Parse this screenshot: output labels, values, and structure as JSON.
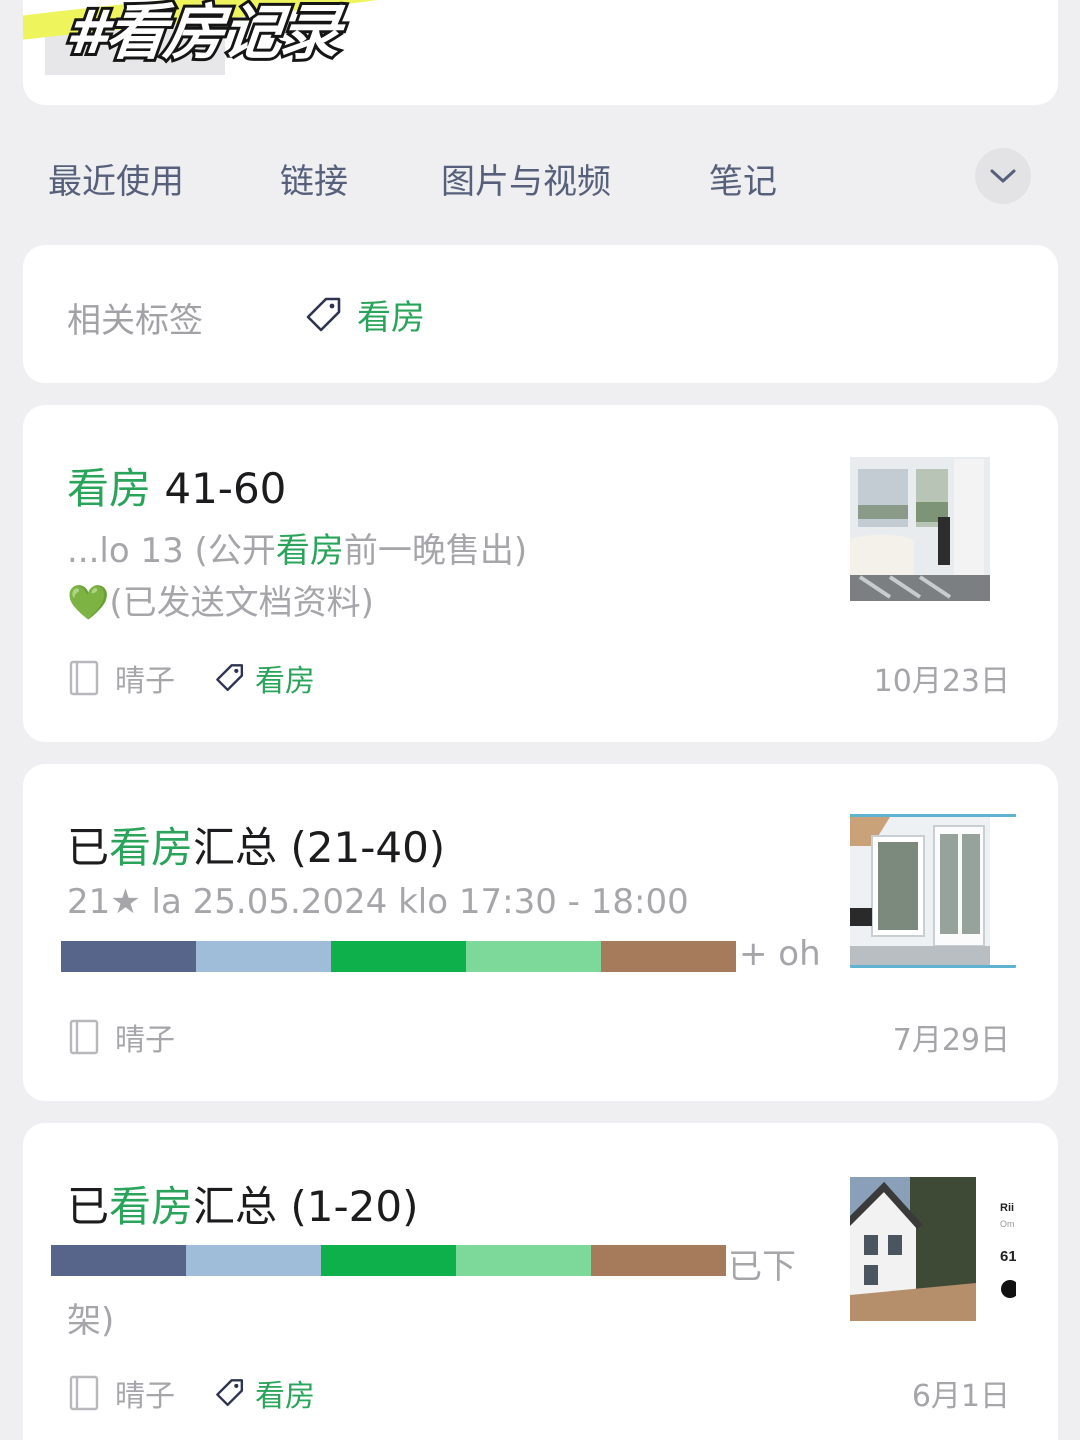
{
  "header": {
    "banner_title": "#看房记录"
  },
  "tabs": [
    {
      "label": "最近使用"
    },
    {
      "label": "链接"
    },
    {
      "label": "图片与视频"
    },
    {
      "label": "笔记"
    }
  ],
  "related_tags": {
    "label": "相关标签",
    "tag": "看房"
  },
  "colors": {
    "accent_green": "#2aa45a",
    "bar_segments": [
      "#566589",
      "#9fbcd9",
      "#0db04b",
      "#7dd99a",
      "#a67b5c"
    ]
  },
  "notes": [
    {
      "title_highlight": "看房",
      "title_rest": " 41-60",
      "line1_pre": "...lo 13 (公开",
      "line1_highlight": "看房",
      "line1_post": "前一晚售出)",
      "line2_emoji": "💚",
      "line2_text": "(已发送文档资料)",
      "author": "晴子",
      "tag": "看房",
      "date": "10月23日",
      "thumbnail_icon": "living-room-photo"
    },
    {
      "title_pre": "已",
      "title_highlight": "看房",
      "title_post": "汇总 (21-40)",
      "line1_text": "21★ la 25.05.2024 klo 17:30 - 18:00",
      "bar_suffix": "+ oh",
      "author": "晴子",
      "date": "7月29日",
      "thumbnail_icon": "bright-room-door-photo"
    },
    {
      "title_pre": "已",
      "title_highlight": "看房",
      "title_post": "汇总 (1-20)",
      "bar_suffix": "已下",
      "line2_text": "架)",
      "author": "晴子",
      "tag": "看房",
      "date": "6月1日",
      "thumbnail_icon": "house-exterior-photo"
    }
  ]
}
